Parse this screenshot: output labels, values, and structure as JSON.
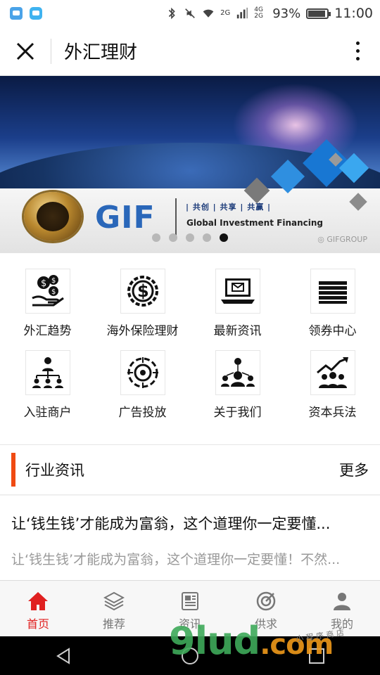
{
  "status_bar": {
    "network_top": "2G",
    "network_bottom": "4G 2G",
    "battery": "93%",
    "time": "11:00"
  },
  "title_bar": {
    "title": "外汇理财"
  },
  "banner": {
    "logo_text": "GIF",
    "slogan": "| 共创 | 共享 | 共赢 |",
    "subtitle": "Global Investment Financing",
    "watermark": "GIFGROUP",
    "active_slide": 5,
    "slide_count": 5
  },
  "grid": [
    {
      "label": "外汇趋势",
      "icon": "money-hand-icon"
    },
    {
      "label": "海外保险理财",
      "icon": "dollar-gear-icon"
    },
    {
      "label": "最新资讯",
      "icon": "laptop-mail-icon"
    },
    {
      "label": "领券中心",
      "icon": "bill-stack-icon"
    },
    {
      "label": "入驻商户",
      "icon": "org-chart-icon"
    },
    {
      "label": "广告投放",
      "icon": "target-gear-icon"
    },
    {
      "label": "关于我们",
      "icon": "team-network-icon"
    },
    {
      "label": "资本兵法",
      "icon": "growth-team-icon"
    }
  ],
  "news": {
    "section_title": "行业资讯",
    "more_label": "更多",
    "items": [
      {
        "title": "让‘钱生钱’才能成为富翁，这个道理你一定要懂...",
        "desc": "让‘钱生钱’才能成为富翁，这个道理你一定要懂！不然..."
      }
    ]
  },
  "tabs": [
    {
      "label": "首页",
      "icon": "home-icon",
      "active": true
    },
    {
      "label": "推荐",
      "icon": "layers-icon",
      "active": false
    },
    {
      "label": "资讯",
      "icon": "newspaper-icon",
      "active": false
    },
    {
      "label": "供求",
      "icon": "target-icon",
      "active": false
    },
    {
      "label": "我的",
      "icon": "user-icon",
      "active": false
    }
  ],
  "watermark": {
    "main": "9lud",
    "suffix": ".com",
    "small": "小 程 序 商 店"
  },
  "colors": {
    "accent": "#f04a12",
    "tab_active": "#e02020",
    "tab_inactive": "#777777"
  }
}
